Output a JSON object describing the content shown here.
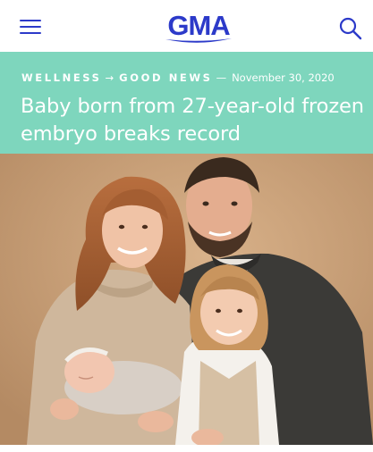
{
  "header": {
    "menu_icon": "hamburger-menu-icon",
    "logo_text": "GMA",
    "search_icon": "search-icon",
    "accent_color": "#2c3ac9"
  },
  "article": {
    "band_color": "#7ed6bd",
    "section": "WELLNESS",
    "separator": "→",
    "subsection": "GOOD NEWS",
    "dash": "—",
    "date": "November 30, 2020",
    "headline": "Baby born from 27-year-old frozen embryo breaks record"
  },
  "image": {
    "subject": "family-portrait-photo"
  }
}
